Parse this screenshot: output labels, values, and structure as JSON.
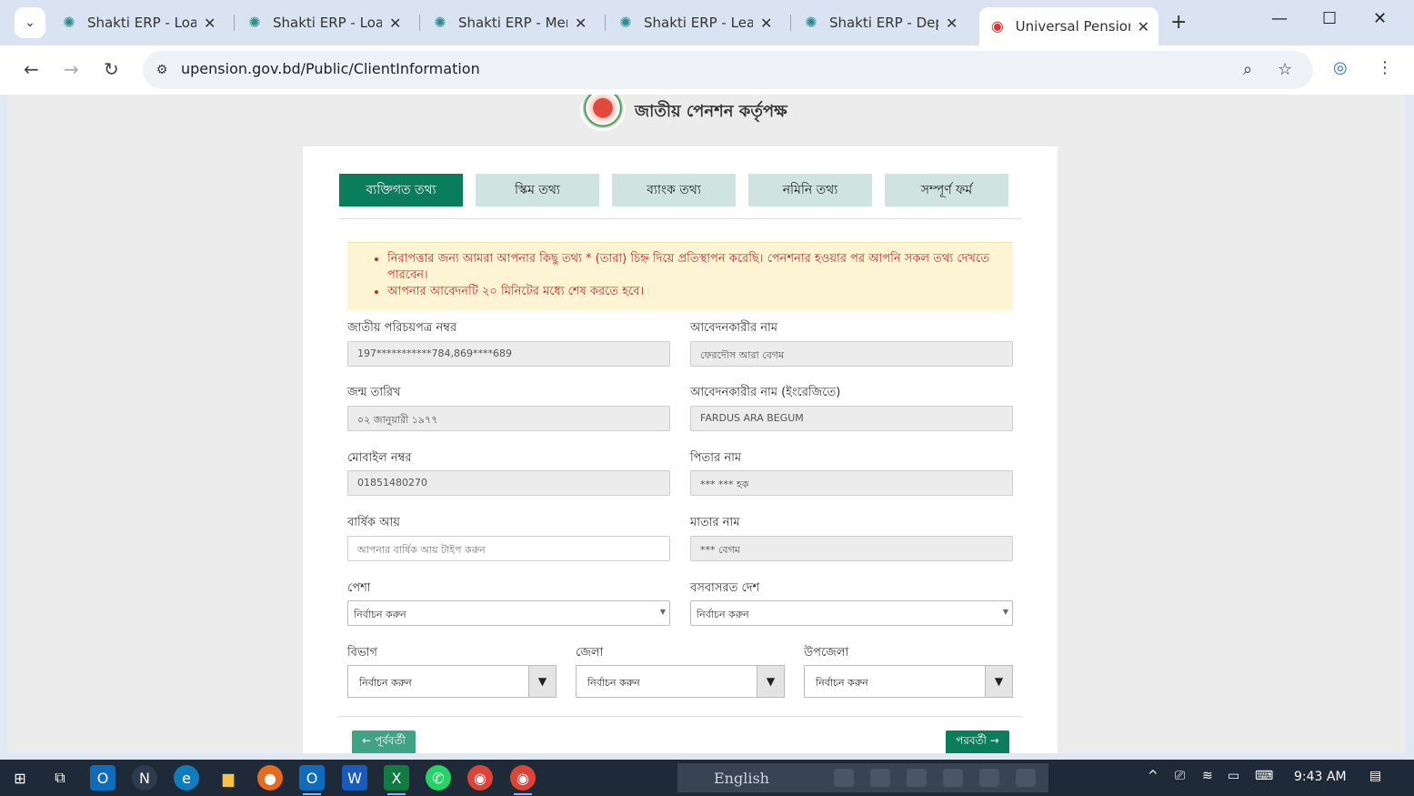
{
  "browser": {
    "tabs": [
      {
        "label": "Shakti ERP - Loan",
        "active": false
      },
      {
        "label": "Shakti ERP - Loan",
        "active": false
      },
      {
        "label": "Shakti ERP - Meml",
        "active": false
      },
      {
        "label": "Shakti ERP - Lead",
        "active": false
      },
      {
        "label": "Shakti ERP - Depo",
        "active": false
      },
      {
        "label": "Universal Pension",
        "active": true
      }
    ],
    "url": "upension.gov.bd/Public/ClientInformation"
  },
  "header": {
    "org_name": "জাতীয় পেনশন কর্তৃপক্ষ"
  },
  "steps": [
    {
      "label": "ব্যক্তিগত তথ্য",
      "active": true
    },
    {
      "label": "স্কিম তথ্য",
      "active": false
    },
    {
      "label": "ব্যাংক তথ্য",
      "active": false
    },
    {
      "label": "নমিনি তথ্য",
      "active": false
    },
    {
      "label": "সম্পূর্ণ ফর্ম",
      "active": false
    }
  ],
  "notice": {
    "line1": "নিরাপত্তার জন্য আমরা আপনার কিছু তথ্য * (তারা) চিহ্ন দিয়ে প্রতিস্থাপন করেছি। পেনশনার হওয়ার পর আপনি সকল তথ্য দেখতে পারবেন।",
    "line2": "আপনার আবেদনটি ২০ মিনিটের মধ্যে শেষ করতে হবে।"
  },
  "form": {
    "nid_label": "জাতীয় পরিচয়পত্র নম্বর",
    "nid_value": "197***********784,869****689",
    "applicant_name_label": "আবেদনকারীর নাম",
    "applicant_name_value": "ফেরদৌস আরা বেগম",
    "dob_label": "জন্ম তারিখ",
    "dob_value": "০২ জানুয়ারী ১৯৭৭",
    "applicant_name_en_label": "আবেদনকারীর নাম (ইংরেজিতে)",
    "applicant_name_en_value": "FARDUS ARA BEGUM",
    "mobile_label": "মোবাইল নম্বর",
    "mobile_value": "01851480270",
    "father_label": "পিতার নাম",
    "father_value": "*** *** হক",
    "income_label": "বার্ষিক আয়",
    "income_placeholder": "আপনার বার্ষিক আয় টাইপ করুন",
    "mother_label": "মাতার নাম",
    "mother_value": "*** বেগম",
    "profession_label": "পেশা",
    "profession_value": "নির্বাচন করুন",
    "country_label": "বসবাসরত দেশ",
    "country_value": "নির্বাচন করুন",
    "division_label": "বিভাগ",
    "division_value": "নির্বাচন করুন",
    "district_label": "জেলা",
    "district_value": "নির্বাচন করুন",
    "upazila_label": "উপজেলা",
    "upazila_value": "নির্বাচন করুন"
  },
  "buttons": {
    "prev": "← পূর্ববর্তী",
    "next": "পরবর্তী →"
  },
  "taskbar": {
    "language": "English",
    "time": "9:43 AM"
  }
}
